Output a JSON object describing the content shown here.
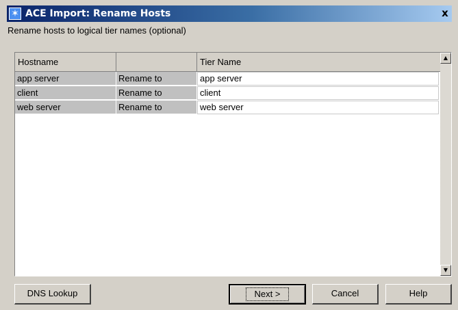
{
  "window": {
    "title": "ACE Import: Rename Hosts",
    "close_glyph": "x",
    "app_icon": "star-icon"
  },
  "instruction": "Rename hosts to logical tier names (optional)",
  "table": {
    "headers": [
      "Hostname",
      "",
      "Tier Name"
    ],
    "rows": [
      {
        "hostname": "app server",
        "action": "Rename to",
        "tier": "app server"
      },
      {
        "hostname": "client",
        "action": "Rename to",
        "tier": "client"
      },
      {
        "hostname": "web server",
        "action": "Rename to",
        "tier": "web server"
      }
    ]
  },
  "buttons": {
    "dns_lookup": "DNS Lookup",
    "next": "Next >",
    "cancel": "Cancel",
    "help": "Help"
  },
  "colors": {
    "title_gradient_start": "#0a246a",
    "face": "#d4d0c8",
    "readonly_cell": "#c0c0c0"
  }
}
